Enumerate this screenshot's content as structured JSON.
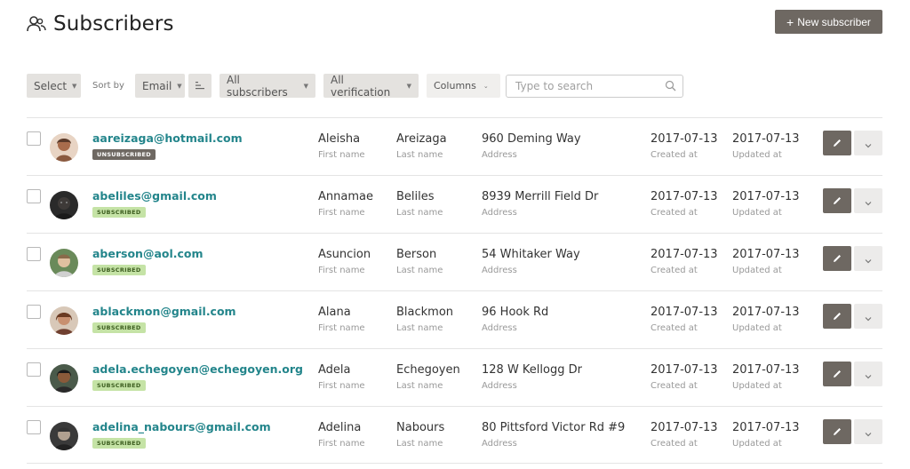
{
  "header": {
    "title": "Subscribers",
    "icon": "users-icon"
  },
  "actions": {
    "new_subscriber": "New subscriber"
  },
  "toolbar": {
    "select": "Select",
    "sort_by": "Sort by",
    "sort_field": "Email",
    "filter_subscribers": "All subscribers",
    "filter_verification": "All verification",
    "columns": "Columns",
    "search_placeholder": "Type to search"
  },
  "labels": {
    "first_name": "First name",
    "last_name": "Last name",
    "address": "Address",
    "created_at": "Created at",
    "updated_at": "Updated at"
  },
  "colors": {
    "accent": "#23858b",
    "button": "#6e6862",
    "subscribed_bg": "#c5e3a6",
    "unsubscribed_bg": "#6e6862"
  },
  "subscribers": [
    {
      "email": "aareizaga@hotmail.com",
      "status": "UNSUBSCRIBED",
      "first_name": "Aleisha",
      "last_name": "Areizaga",
      "address": "960 Deming Way",
      "created_at": "2017-07-13",
      "updated_at": "2017-07-13"
    },
    {
      "email": "abeliles@gmail.com",
      "status": "SUBSCRIBED",
      "first_name": "Annamae",
      "last_name": "Beliles",
      "address": "8939 Merrill Field Dr",
      "created_at": "2017-07-13",
      "updated_at": "2017-07-13"
    },
    {
      "email": "aberson@aol.com",
      "status": "SUBSCRIBED",
      "first_name": "Asuncion",
      "last_name": "Berson",
      "address": "54 Whitaker Way",
      "created_at": "2017-07-13",
      "updated_at": "2017-07-13"
    },
    {
      "email": "ablackmon@gmail.com",
      "status": "SUBSCRIBED",
      "first_name": "Alana",
      "last_name": "Blackmon",
      "address": "96 Hook Rd",
      "created_at": "2017-07-13",
      "updated_at": "2017-07-13"
    },
    {
      "email": "adela.echegoyen@echegoyen.org",
      "status": "SUBSCRIBED",
      "first_name": "Adela",
      "last_name": "Echegoyen",
      "address": "128 W Kellogg Dr",
      "created_at": "2017-07-13",
      "updated_at": "2017-07-13"
    },
    {
      "email": "adelina_nabours@gmail.com",
      "status": "SUBSCRIBED",
      "first_name": "Adelina",
      "last_name": "Nabours",
      "address": "80 Pittsford Victor Rd #9",
      "created_at": "2017-07-13",
      "updated_at": "2017-07-13"
    }
  ]
}
